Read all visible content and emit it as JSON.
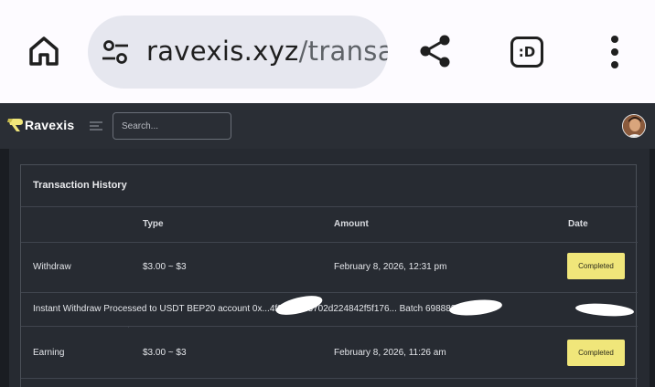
{
  "browser": {
    "url_domain": "ravexis.xyz",
    "url_path": "/transa",
    "tab_label": ":D",
    "icons": [
      "home-icon",
      "tune-icon",
      "share-icon",
      "more-vert-icon"
    ]
  },
  "navbar": {
    "brand": "Ravexis",
    "search_placeholder": "Search...",
    "brand_color": "#f0e67a"
  },
  "transactions": {
    "title": "Transaction History",
    "columns": [
      "",
      "Type",
      "Amount",
      "Date"
    ],
    "rows": [
      {
        "label": "Withdraw",
        "type": "$3.00 ~ $3",
        "amount": "February 8, 2026, 12:31 pm",
        "status": "Completed"
      },
      {
        "label": "Earning",
        "type": "$3.00 ~ $3",
        "amount": "February 8, 2026, 11:26 am",
        "status": "Completed"
      }
    ],
    "note": "Instant Withdraw Processed to USDT BEP20 account 0x...4f27b7ed3702d224842f5f176... Batch 6988823...",
    "badge_color": "#f0e67a"
  }
}
